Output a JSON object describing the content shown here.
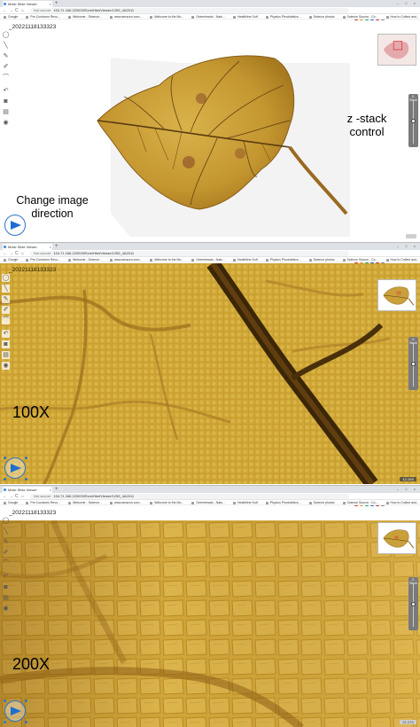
{
  "browser": {
    "tab_title": "Motic Slide Viewer",
    "new_tab": "+",
    "window_controls": "– □ ×",
    "nav": {
      "back": "←",
      "forward": "→",
      "reload": "C",
      "home": "⌂"
    },
    "security": "Not secure",
    "url": "104.71.166.22/0030Svm/HtmlViewer/1259_4A2011",
    "bookmarks": [
      "Google",
      "Pre-Condoms Revu...",
      "Welcome - Science...",
      "www.amazon.com...",
      "Welcome to the Mo...",
      "Greenheads - Natu...",
      "Healthline Soft",
      "Physics Phodolintics...",
      "Science photos",
      "Science Source - Co...",
      "How to Collect and...",
      "Photographing Ob...",
      "Freshwater and Mi..."
    ]
  },
  "viewer": {
    "slide_id": "_20221118133323",
    "tools": [
      "pan-icon",
      "measure-line-icon",
      "pen-icon",
      "edit-icon",
      "curve-icon",
      "undo-icon",
      "camera-icon",
      "print-icon",
      "eye-icon"
    ],
    "zstack_label": "Z-Stack",
    "zoom_badges": [
      "",
      "12.19X",
      "21.27X"
    ]
  },
  "annotations": {
    "zstack": "z -stack\ncontrol",
    "direction": "Change image\ndirection",
    "mag_100": "100X",
    "mag_200": "200X"
  },
  "colors": {
    "leaf": "#c8a23a",
    "leaf_vein": "#5a3c10",
    "compass": "#2e72c8",
    "zstack_bg": "#7a7a7a"
  }
}
